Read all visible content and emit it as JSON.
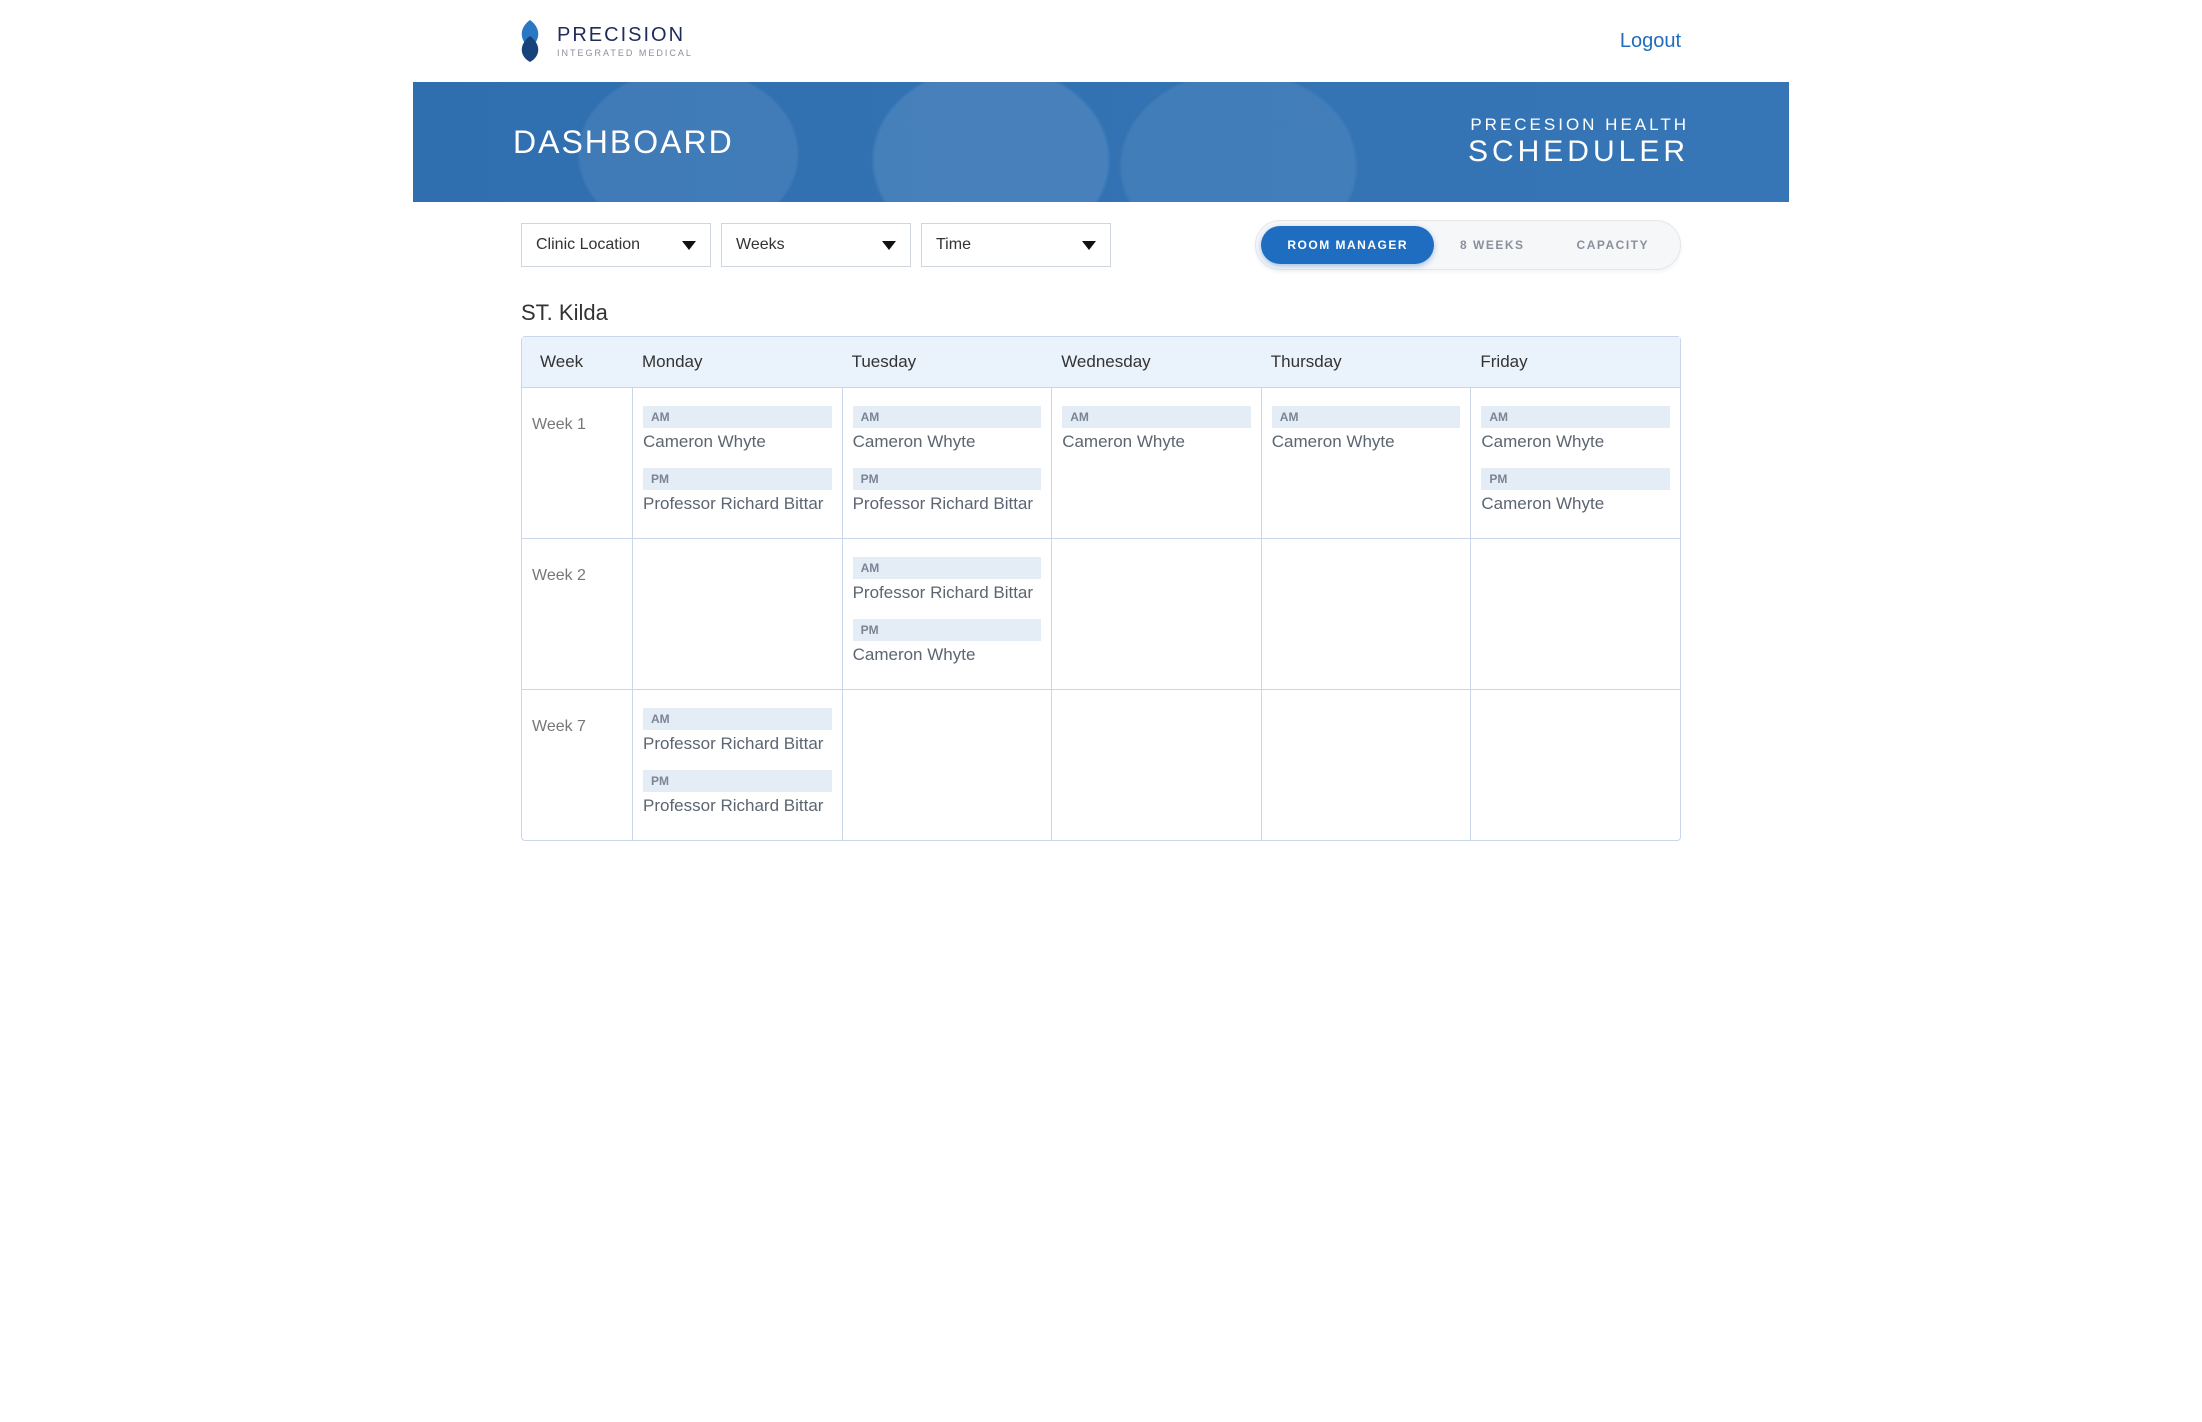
{
  "brand": {
    "name": "PRECISION",
    "sub": "INTEGRATED MEDICAL"
  },
  "header": {
    "logout": "Logout"
  },
  "hero": {
    "title": "DASHBOARD",
    "app_top": "PRECESION HEALTH",
    "app_main": "SCHEDULER"
  },
  "controls": {
    "dropdowns": {
      "location_label": "Clinic Location",
      "weeks_label": "Weeks",
      "time_label": "Time"
    },
    "tabs": {
      "room_manager": "ROOM MANAGER",
      "eight_weeks": "8 WEEKS",
      "capacity": "CAPACITY"
    }
  },
  "location_heading": "ST. Kilda",
  "days": [
    "Week",
    "Monday",
    "Tuesday",
    "Wednesday",
    "Thursday",
    "Friday"
  ],
  "slot_labels": {
    "am": "AM",
    "pm": "PM"
  },
  "rows": [
    {
      "week": "Week 1",
      "cells": [
        {
          "am": "Cameron Whyte",
          "pm": "Professor Richard Bittar"
        },
        {
          "am": "Cameron Whyte",
          "pm": "Professor Richard Bittar"
        },
        {
          "am": "Cameron Whyte"
        },
        {
          "am": "Cameron Whyte"
        },
        {
          "am": "Cameron Whyte",
          "pm": "Cameron Whyte"
        }
      ]
    },
    {
      "week": "Week 2",
      "cells": [
        {},
        {
          "am": "Professor Richard Bittar",
          "pm": "Cameron Whyte"
        },
        {},
        {},
        {}
      ]
    },
    {
      "week": "Week 7",
      "cells": [
        {
          "am": "Professor Richard Bittar",
          "pm": "Professor Richard Bittar"
        },
        {},
        {},
        {},
        {}
      ]
    }
  ],
  "colors": {
    "accent": "#1f6dc0",
    "banner": "#2f6fb0",
    "slot_bg": "#e4edf6",
    "header_bg": "#eaf2fb",
    "border": "#c9d7e8"
  }
}
